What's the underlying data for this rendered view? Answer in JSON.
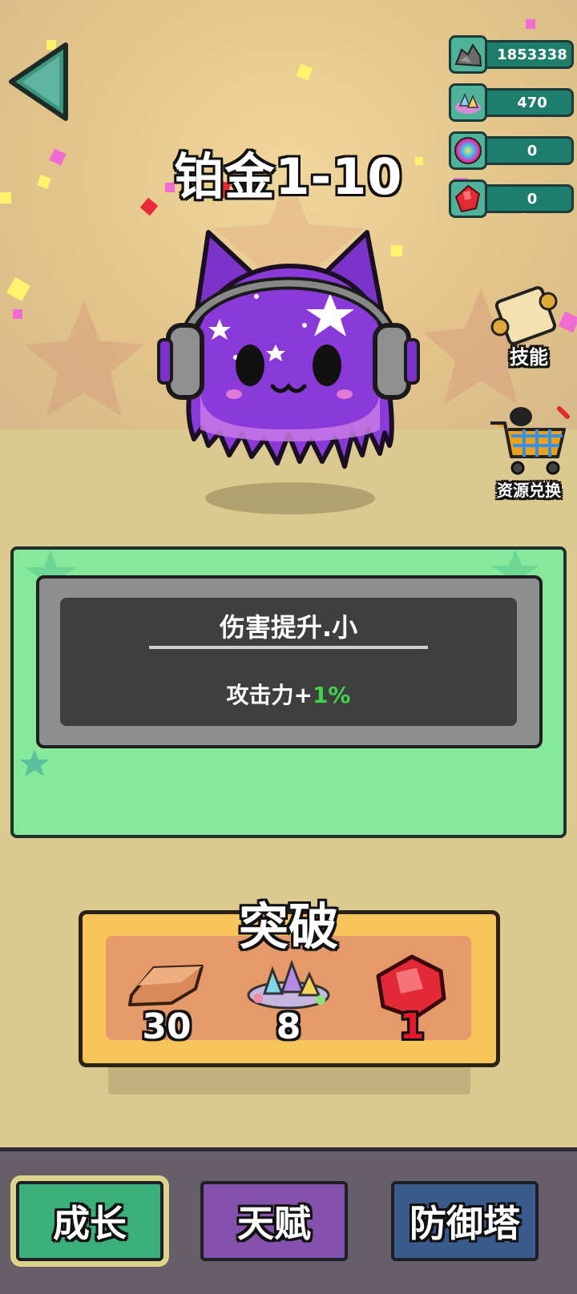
{
  "header": {
    "title": "铂金1-10"
  },
  "resources": [
    {
      "name": "iron",
      "icon": "ore-icon",
      "value": "1853338"
    },
    {
      "name": "crystal",
      "icon": "crystal-pile-icon",
      "value": "470"
    },
    {
      "name": "orb",
      "icon": "rainbow-orb-icon",
      "value": "0"
    },
    {
      "name": "ruby",
      "icon": "ruby-icon",
      "value": "0"
    }
  ],
  "side_buttons": {
    "skills_label": "技能",
    "exchange_label": "资源兑换"
  },
  "skill_card": {
    "name": "伤害提升.小",
    "effect_prefix": "攻击力+",
    "effect_value": "1%"
  },
  "breakthrough": {
    "title": "突破",
    "costs": [
      {
        "item": "copper-bar-icon",
        "amount": "30"
      },
      {
        "item": "crystal-pile-icon",
        "amount": "8"
      },
      {
        "item": "ruby-icon",
        "amount": "1"
      }
    ]
  },
  "tabs": {
    "grow": "成长",
    "talent": "天赋",
    "tower": "防御塔"
  },
  "colors": {
    "panel_green": "#86e89b",
    "active_tab": "#3cb07a",
    "talent_tab": "#8451ad",
    "tower_tab": "#3a5a8c",
    "effect_green": "#3fd24a",
    "cost_red": "#e5172c"
  }
}
